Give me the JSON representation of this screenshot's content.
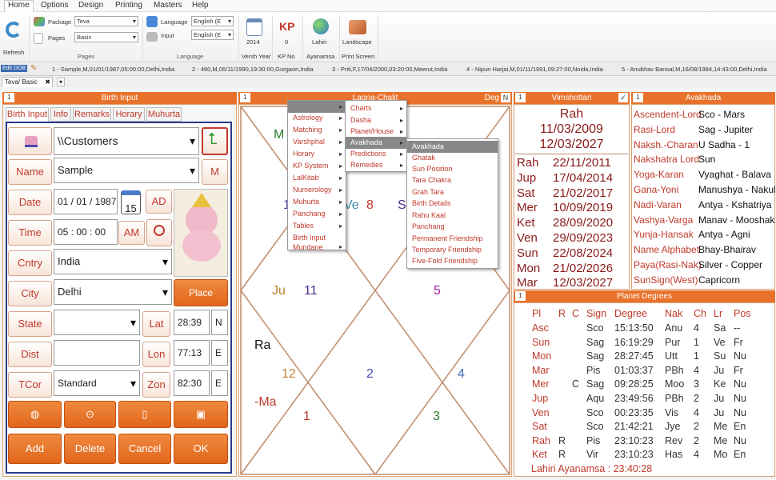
{
  "menu": [
    "Home",
    "Options",
    "Design",
    "Printing",
    "Masters",
    "Help"
  ],
  "ribbon": {
    "refresh": "Refresh",
    "package_label": "Package",
    "package_value": "Teva",
    "pages_label": "Pages",
    "pages_value": "Basic",
    "pages_group": "Pages",
    "language_label": "Language",
    "language_value": "English (E",
    "input_label": "Input",
    "input_value": "English (E",
    "language_group": "Language",
    "versh_year_value": "2014",
    "versh_year_label": "Versh Year",
    "kp_icon": "KP",
    "kp_value": "0",
    "kp_label": "KP No",
    "lahiri_value": "Lahiri",
    "ayanamsa_label": "Ayanamsa",
    "landscape_value": "Landscape",
    "print_label": "Print Screen"
  },
  "records": {
    "edit_label": "Edit DOB",
    "items": [
      "1 - Sample,M,01/01/1987,05:00:00,Delhi,India",
      "2 - 460,M,06/11/1990,19:30:00,Gurgaon,India",
      "3 - Priti,F,17/04/2000,03:20:00,Meerut,India",
      "4 - Nipun Harjai,M,01/11/1991,09:27:00,Noida,India",
      "5 - Anubhav Bansal,M,16/08/1984,14:43:00,Delhi,India"
    ]
  },
  "doc_tab": "Teva/ Basic",
  "birth_input": {
    "title": "Birth Input",
    "num": "1",
    "tabs": [
      "Birth Input",
      "Info",
      "Remarks",
      "Horary",
      "Muhurta"
    ],
    "path": "\\\\Customers",
    "name_label": "Name",
    "name_value": "Sample",
    "m_btn": "M",
    "date_label": "Date",
    "date_value": "01 / 01 / 1987",
    "cal_value": "15",
    "ad_btn": "AD",
    "time_label": "Time",
    "time_value": "05 :  00 :  00",
    "am_btn": "AM",
    "cntry_label": "Cntry",
    "cntry_value": "India",
    "city_label": "City",
    "city_value": "Delhi",
    "place_finder": "Place Finder",
    "state_label": "State",
    "state_value": "",
    "lat_label": "Lat",
    "lat_value": "28:39",
    "lat_dir": "N",
    "dist_label": "Dist",
    "dist_value": "",
    "lon_label": "Lon",
    "lon_value": "77:13",
    "lon_dir": "E",
    "tcor_label": "TCor",
    "tcor_value": "Standard",
    "zon_label": "Zon",
    "zon_value": "82:30",
    "zon_dir": "E",
    "add": "Add",
    "delete": "Delete",
    "cancel": "Cancel",
    "ok": "OK"
  },
  "chart": {
    "num": "1",
    "title": "Lagna-Chalit",
    "deg_label": "Deg",
    "n_label": "N",
    "labels": [
      {
        "t": "M",
        "c": "#2a7a2a"
      },
      {
        "t": "1",
        "c": "#4a4ab0"
      },
      {
        "t": "Ve",
        "c": "#3a8ab0"
      },
      {
        "t": "8",
        "c": "#c0392b"
      },
      {
        "t": "S",
        "c": "#4a2a90"
      },
      {
        "t": "Ju",
        "c": "#c08030"
      },
      {
        "t": "11",
        "c": "#4a2a90"
      },
      {
        "t": "5",
        "c": "#a020a0"
      },
      {
        "t": "Ra",
        "c": "#111111"
      },
      {
        "t": "12",
        "c": "#c08030"
      },
      {
        "t": "2",
        "c": "#4a4ab0"
      },
      {
        "t": "4",
        "c": "#3a6ab0"
      },
      {
        "t": "-Ma",
        "c": "#c0392b"
      },
      {
        "t": "1",
        "c": "#c0392b"
      },
      {
        "t": "3",
        "c": "#2a7a2a"
      }
    ]
  },
  "menus": {
    "main": [
      "Astrology",
      "Matching",
      "Varshphal",
      "Horary",
      "KP System",
      "LalKitab",
      "Numerology",
      "Muhurta",
      "Panchang",
      "Tables",
      "Birth Input",
      "Mundane"
    ],
    "sub": [
      "Charts",
      "Dasha",
      "Planet/House",
      "Avakhada",
      "Predictions",
      "Remedies"
    ],
    "sub2": [
      "Avakhada",
      "Ghatak",
      "Sun Position",
      "Tara Chakra",
      "Grah Tara",
      "Birth Details",
      "Rahu Kaal",
      "Panchang",
      "Permanent Friendship",
      "Temporary Friendship",
      "Five-Fold Friendship"
    ]
  },
  "vimshottari": {
    "num": "1",
    "title": "Vimshottari",
    "check": "✓",
    "lord": "Rah",
    "start": "11/03/2009",
    "end": "12/03/2027",
    "rows": [
      {
        "p": "Rah",
        "d": "22/11/2011"
      },
      {
        "p": "Jup",
        "d": "17/04/2014"
      },
      {
        "p": "Sat",
        "d": "21/02/2017"
      },
      {
        "p": "Mer",
        "d": "10/09/2019"
      },
      {
        "p": "Ket",
        "d": "28/09/2020"
      },
      {
        "p": "Ven",
        "d": "29/09/2023"
      },
      {
        "p": "Sun",
        "d": "22/08/2024"
      },
      {
        "p": "Mon",
        "d": "21/02/2026"
      },
      {
        "p": "Mar",
        "d": "12/03/2027"
      }
    ]
  },
  "avakhada": {
    "num": "1",
    "title": "Avakhada",
    "rows": [
      {
        "k": "Ascendent-Lord",
        "v": "Sco - Mars"
      },
      {
        "k": "Rasi-Lord",
        "v": "Sag - Jupiter"
      },
      {
        "k": "Naksh.-Charan",
        "v": "U Sadha - 1"
      },
      {
        "k": "Nakshatra Lord",
        "v": "Sun"
      },
      {
        "k": "Yoga-Karan",
        "v": "Vyaghat - Balava"
      },
      {
        "k": "Gana-Yoni",
        "v": "Manushya - Nakul"
      },
      {
        "k": "Nadi-Varan",
        "v": "Antya - Kshatriya"
      },
      {
        "k": "Vashya-Varga",
        "v": "Manav - Mooshak"
      },
      {
        "k": "Yunja-Hansak",
        "v": "Antya - Agni"
      },
      {
        "k": "Name Alphabet",
        "v": "Bhay-Bhairav"
      },
      {
        "k": "Paya(Rasi-Nak)",
        "v": "Silver - Copper"
      },
      {
        "k": "SunSign(West)",
        "v": "Capricorn"
      }
    ]
  },
  "planet_degrees": {
    "num": "1",
    "title": "Planet Degrees",
    "headers": [
      "Pl",
      "R",
      "C",
      "Sign",
      "Degree",
      "Nak",
      "Ch",
      "Lr",
      "Pos"
    ],
    "rows": [
      {
        "pl": "Asc",
        "r": "",
        "c": "",
        "sign": "Sco",
        "deg": "15:13:50",
        "nak": "Anu",
        "ch": "4",
        "lr": "Sa",
        "pos": "--"
      },
      {
        "pl": "Sun",
        "r": "",
        "c": "",
        "sign": "Sag",
        "deg": "16:19:29",
        "nak": "Pur",
        "ch": "1",
        "lr": "Ve",
        "pos": "Fr"
      },
      {
        "pl": "Mon",
        "r": "",
        "c": "",
        "sign": "Sag",
        "deg": "28:27:45",
        "nak": "Utt",
        "ch": "1",
        "lr": "Su",
        "pos": "Nu"
      },
      {
        "pl": "Mar",
        "r": "",
        "c": "",
        "sign": "Pis",
        "deg": "01:03:37",
        "nak": "PBh",
        "ch": "4",
        "lr": "Ju",
        "pos": "Fr"
      },
      {
        "pl": "Mer",
        "r": "",
        "c": "C",
        "sign": "Sag",
        "deg": "09:28:25",
        "nak": "Moo",
        "ch": "3",
        "lr": "Ke",
        "pos": "Nu"
      },
      {
        "pl": "Jup",
        "r": "",
        "c": "",
        "sign": "Aqu",
        "deg": "23:49:56",
        "nak": "PBh",
        "ch": "2",
        "lr": "Ju",
        "pos": "Nu"
      },
      {
        "pl": "Ven",
        "r": "",
        "c": "",
        "sign": "Sco",
        "deg": "00:23:35",
        "nak": "Vis",
        "ch": "4",
        "lr": "Ju",
        "pos": "Nu"
      },
      {
        "pl": "Sat",
        "r": "",
        "c": "",
        "sign": "Sco",
        "deg": "21:42:21",
        "nak": "Jye",
        "ch": "2",
        "lr": "Me",
        "pos": "En"
      },
      {
        "pl": "Rah",
        "r": "R",
        "c": "",
        "sign": "Pis",
        "deg": "23:10:23",
        "nak": "Rev",
        "ch": "2",
        "lr": "Me",
        "pos": "Nu"
      },
      {
        "pl": "Ket",
        "r": "R",
        "c": "",
        "sign": "Vir",
        "deg": "23:10:23",
        "nak": "Has",
        "ch": "4",
        "lr": "Mo",
        "pos": "En"
      }
    ],
    "footer": "Lahiri Ayanamsa : 23:40:28"
  }
}
